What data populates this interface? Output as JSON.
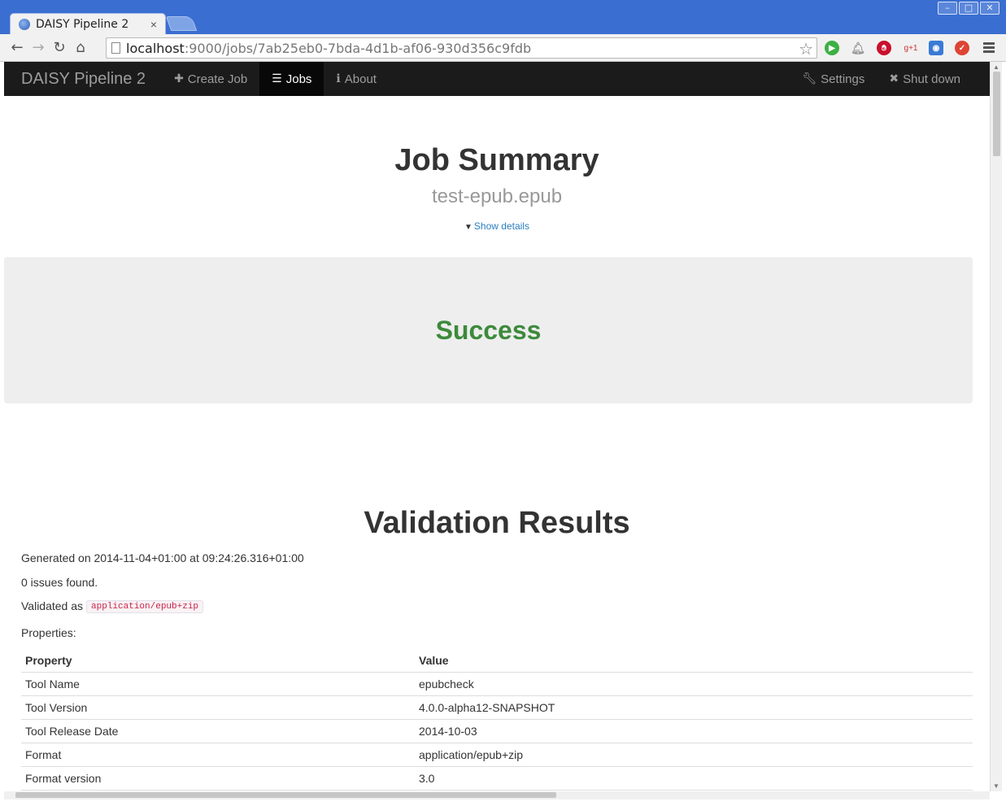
{
  "browser": {
    "tab_title": "DAISY Pipeline 2",
    "tab_close": "×",
    "url_host": "localhost",
    "url_rest": ":9000/jobs/7ab25eb0-7bda-4d1b-af06-930d356c9fdb",
    "extension_gplus": "g+1"
  },
  "navbar": {
    "brand": "DAISY Pipeline 2",
    "create_job": "Create Job",
    "jobs": "Jobs",
    "about": "About",
    "settings": "Settings",
    "shut_down": "Shut down"
  },
  "job": {
    "title": "Job Summary",
    "file": "test-epub.epub",
    "show_details": "Show details",
    "status": "Success"
  },
  "validation": {
    "title": "Validation Results",
    "generated": "Generated on 2014-11-04+01:00 at 09:24:26.316+01:00",
    "issues": "0 issues found.",
    "validated_as_label": "Validated as",
    "validated_as_value": "application/epub+zip",
    "properties_label": "Properties:",
    "table": {
      "headers": [
        "Property",
        "Value"
      ],
      "rows": [
        [
          "Tool Name",
          "epubcheck"
        ],
        [
          "Tool Version",
          "4.0.0-alpha12-SNAPSHOT"
        ],
        [
          "Tool Release Date",
          "2014-10-03"
        ],
        [
          "Format",
          "application/epub+zip"
        ],
        [
          "Format version",
          "3.0"
        ]
      ]
    }
  }
}
